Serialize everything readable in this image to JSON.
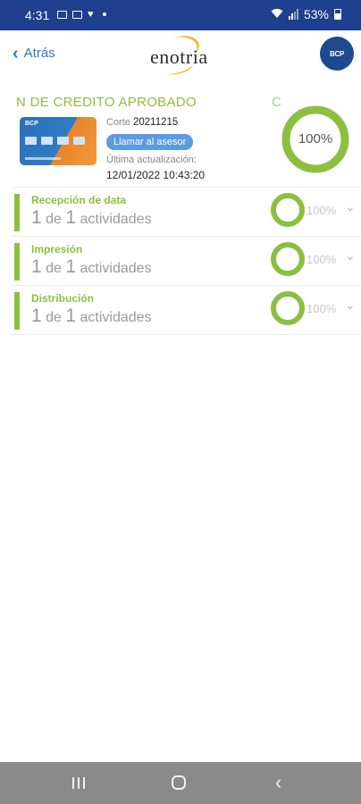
{
  "status_bar": {
    "time": "4:31",
    "battery": "53%"
  },
  "nav": {
    "back_label": "Atrás",
    "logo_text": "enotria",
    "avatar_text": "BCP"
  },
  "header": {
    "title": "N DE CREDITO APROBADO",
    "side_letter": "C",
    "card_brand": "BCP",
    "corte_label": "Corte",
    "corte_value": "20211215",
    "advisor_button": "Llamar al asesor",
    "updated_label": "Última actualización:",
    "updated_value": "12/01/2022 10:43:20",
    "overall_progress": "100%",
    "overall_progress_fraction": 1.0
  },
  "stages": [
    {
      "title": "Recepción de data",
      "done": "1",
      "of": "de",
      "total": "1",
      "unit": "actividades",
      "percent": "100%",
      "fraction": 1.0
    },
    {
      "title": "Impresión",
      "done": "1",
      "of": "de",
      "total": "1",
      "unit": "actividades",
      "percent": "100%",
      "fraction": 1.0
    },
    {
      "title": "Distribución",
      "done": "1",
      "of": "de",
      "total": "1",
      "unit": "actividades",
      "percent": "100%",
      "fraction": 1.0
    }
  ],
  "colors": {
    "accent_green": "#8cbf3f",
    "status_bar": "#1f3f8f",
    "link_blue": "#2f78c4",
    "pill_blue": "#5b9be0"
  },
  "icons": {
    "back": "chevron-left-icon",
    "expand": "chevron-down-icon",
    "recent_apps": "recent-apps-icon",
    "home": "home-icon",
    "system_back": "system-back-icon"
  }
}
